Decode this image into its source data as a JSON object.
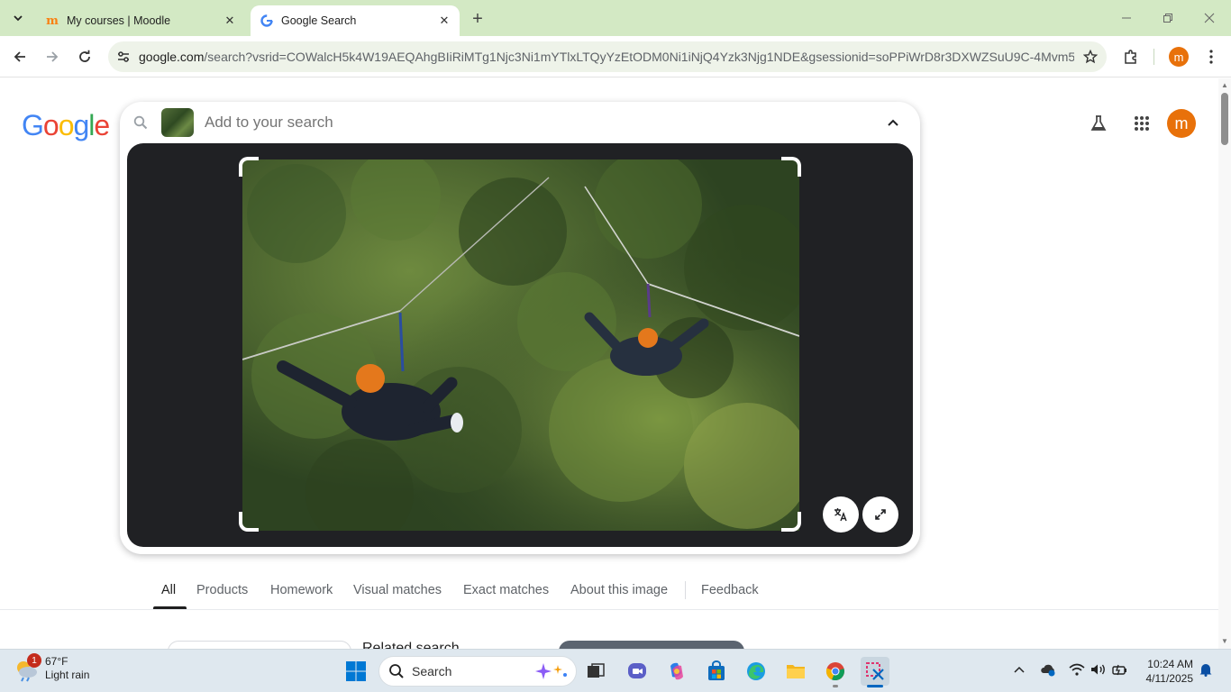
{
  "browser": {
    "tabs": [
      {
        "title": "My courses | Moodle",
        "favicon": "moodle-icon",
        "active": false
      },
      {
        "title": "Google Search",
        "favicon": "google-g-icon",
        "active": true
      }
    ],
    "url_host": "google.com",
    "url_path": "/search?vsrid=COWalcH5k4W19AEQAhgBIiRiMTg1Njc3Ni1mYTlxLTQyYzEtODM0Ni1iNjQ4Yzk3Njg1NDE&gsessionid=soPPiWrD8r3DXWZSuU9C-4Mvm5...",
    "profile_initial": "m"
  },
  "google": {
    "logo_letters": [
      "G",
      "o",
      "o",
      "g",
      "l",
      "e"
    ],
    "search_placeholder": "Add to your search",
    "avatar_initial": "m",
    "filter_tabs": [
      "All",
      "Products",
      "Homework",
      "Visual matches",
      "Exact matches",
      "About this image",
      "Feedback"
    ],
    "active_tab": "All",
    "results_heading_partial": "Related search"
  },
  "taskbar": {
    "weather_temp": "67°F",
    "weather_desc": "Light rain",
    "weather_badge": "1",
    "search_label": "Search",
    "time": "10:24 AM",
    "date": "4/11/2025"
  },
  "colors": {
    "tabstrip": "#d3e9c4",
    "omnibox": "#eef3e9",
    "lens_bg": "#202124",
    "avatar": "#e8710a",
    "google_blue": "#4285f4",
    "google_red": "#ea4335",
    "google_yellow": "#fbbc05",
    "google_green": "#34a853"
  }
}
